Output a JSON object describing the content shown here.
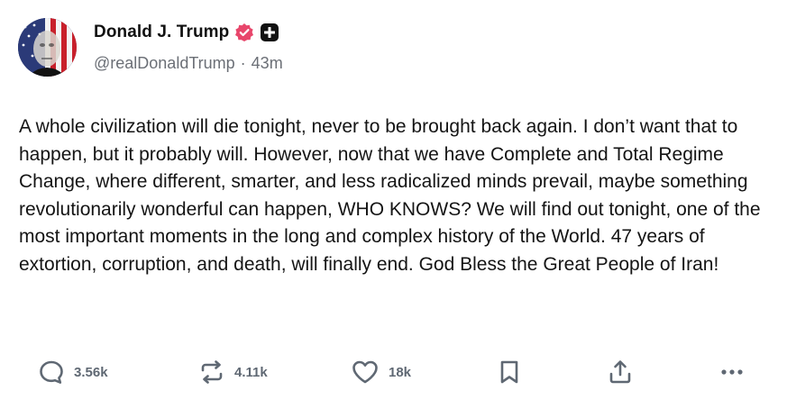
{
  "author": {
    "display_name": "Donald J. Trump",
    "handle": "@realDonaldTrump",
    "separator": "·",
    "timestamp": "43m"
  },
  "badges": {
    "verified_color": "#e8466b",
    "sub_badge_color": "#111111"
  },
  "post": {
    "text": "A whole civilization will die tonight, never to be brought back again. I don’t want that to happen, but it probably will. However, now that we have Complete and Total Regime Change, where different, smarter, and less radicalized minds prevail, maybe something revolutionarily wonderful can happen, WHO KNOWS? We will find out tonight, one of the most important moments in the long and complex history of the World. 47 years of extortion, corruption, and death, will finally end. God Bless the Great People of Iran!"
  },
  "actions": {
    "reply": {
      "icon": "reply-icon",
      "count": "3.56k"
    },
    "repost": {
      "icon": "repost-icon",
      "count": "4.11k"
    },
    "like": {
      "icon": "heart-icon",
      "count": "18k"
    },
    "bookmark": {
      "icon": "bookmark-icon"
    },
    "share": {
      "icon": "share-icon"
    },
    "more": {
      "icon": "more-icon"
    }
  }
}
